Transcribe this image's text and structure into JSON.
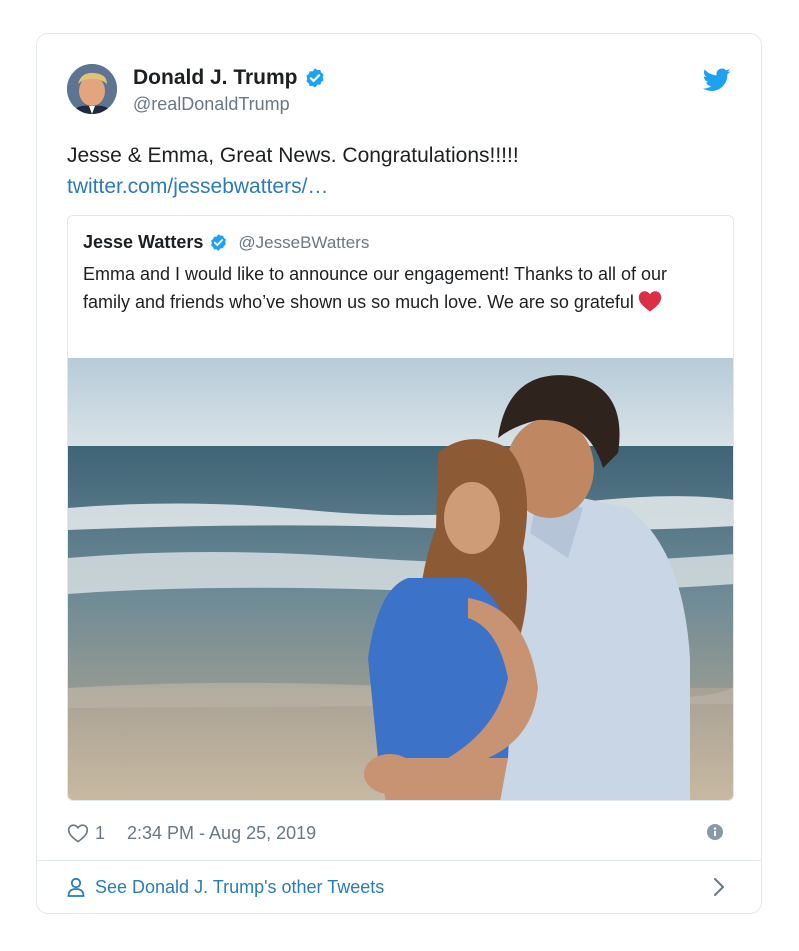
{
  "tweet": {
    "author": {
      "name": "Donald J. Trump",
      "handle": "@realDonaldTrump",
      "verified": true
    },
    "text": "Jesse & Emma, Great News. Congratulations!!!!!",
    "link": "twitter.com/jessebwatters/…",
    "likes": "1",
    "timestamp": "2:34 PM - Aug 25, 2019",
    "cta": "See Donald J. Trump's other Tweets"
  },
  "quoted": {
    "name": "Jesse Watters",
    "handle": "@JesseBWatters",
    "verified": true,
    "text": "Emma and I would like to announce our engagement! Thanks to all of our family and friends who’ve shown us so much love. We are so grateful",
    "emoji": "red-heart-icon"
  },
  "colors": {
    "link": "#2b7bb9",
    "verified": "#1da1f2",
    "muted": "#697882",
    "border": "#e1e8ed",
    "heart": "#e0245e"
  },
  "icons": [
    "twitter-bird-icon",
    "verified-badge-icon",
    "heart-outline-icon",
    "info-icon",
    "person-icon",
    "chevron-right-icon"
  ]
}
